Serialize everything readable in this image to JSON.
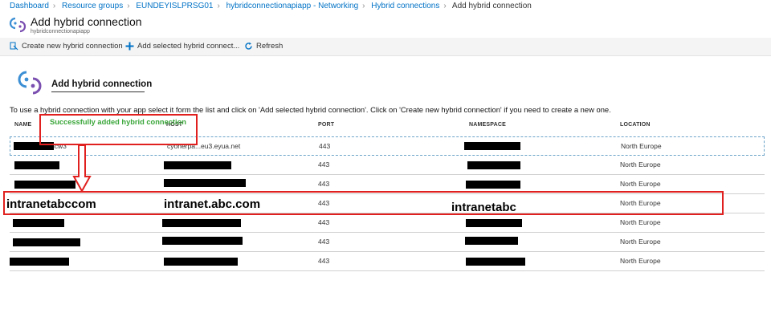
{
  "breadcrumb": [
    "Dashboard",
    "Resource groups",
    "EUNDEYISLPRSG01",
    "hybridconnectionapiapp - Networking",
    "Hybrid connections",
    "Add hybrid connection"
  ],
  "blade": {
    "title": "Add hybrid connection",
    "subtitle": "hybridconnectionapiapp"
  },
  "commands": {
    "create": "Create new hybrid connection",
    "add_selected": "Add selected hybrid connect...",
    "refresh": "Refresh"
  },
  "section": {
    "title": "Add hybrid connection",
    "instructions": "To use a hybrid connection with your app select it form the list and click on 'Add selected hybrid connection'. Click on 'Create new hybrid connection' if you need to create a new one."
  },
  "table": {
    "columns": [
      "NAME",
      "HOST",
      "PORT",
      "NAMESPACE",
      "LOCATION"
    ],
    "rows": [
      {
        "name": "hcw3",
        "host": "cyonerpa...eu3.eyua.net",
        "port": "443",
        "namespace": "",
        "location": "North Europe"
      },
      {
        "name": "",
        "host": "",
        "port": "443",
        "namespace": "",
        "location": "North Europe"
      },
      {
        "name": "",
        "host": "",
        "port": "443",
        "namespace": "",
        "location": "North Europe"
      },
      {
        "name": "",
        "host": "",
        "port": "443",
        "namespace": "",
        "location": "North Europe"
      },
      {
        "name": "",
        "host": "",
        "port": "443",
        "namespace": "",
        "location": "North Europe"
      },
      {
        "name": "",
        "host": "",
        "port": "443",
        "namespace": "",
        "location": "North Europe"
      },
      {
        "name": "",
        "host": "",
        "port": "443",
        "namespace": "",
        "location": "North Europe"
      }
    ]
  },
  "annotations": {
    "success": "Successfully added hybrid connection",
    "name": "intranetabccom",
    "host": "intranet.abc.com",
    "namespace": "intranetabc"
  },
  "colors": {
    "link": "#0072c6",
    "annotation_red": "#e0201e",
    "success_green": "#3aa63a"
  }
}
